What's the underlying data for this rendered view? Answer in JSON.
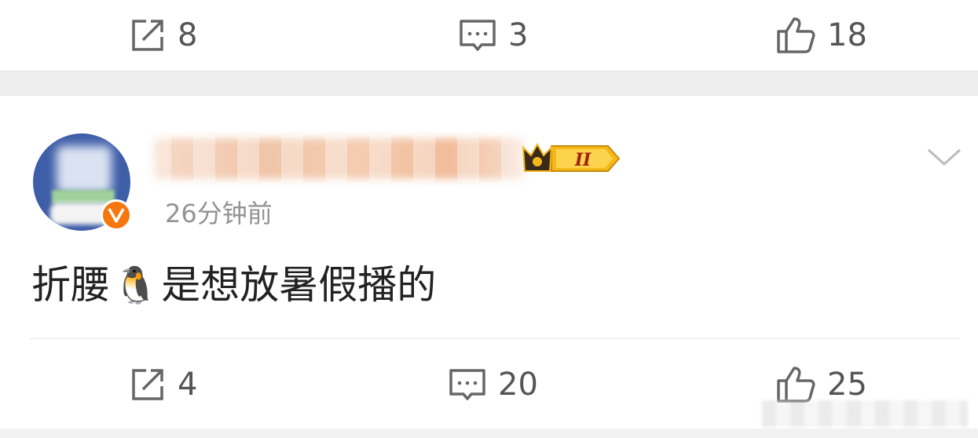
{
  "top_actions": {
    "repost": {
      "icon": "repost-icon",
      "count": "8"
    },
    "comment": {
      "icon": "comment-icon",
      "count": "3"
    },
    "like": {
      "icon": "like-icon",
      "count": "18"
    }
  },
  "comment": {
    "username": "",
    "timestamp": "26分钟前",
    "text_before_emoji": "折腰",
    "emoji": "🐧",
    "text_after_emoji": "是想放暑假播的",
    "badge_level": "II",
    "verified": true,
    "colors": {
      "verify_badge": "#f6770f",
      "avatar_bg": "#3f5ea8",
      "level_badge": "#f5b81b"
    }
  },
  "bottom_actions": {
    "repost": {
      "icon": "repost-icon",
      "count": "4"
    },
    "comment": {
      "icon": "comment-icon",
      "count": "20"
    },
    "like": {
      "icon": "like-icon",
      "count": "25"
    }
  }
}
